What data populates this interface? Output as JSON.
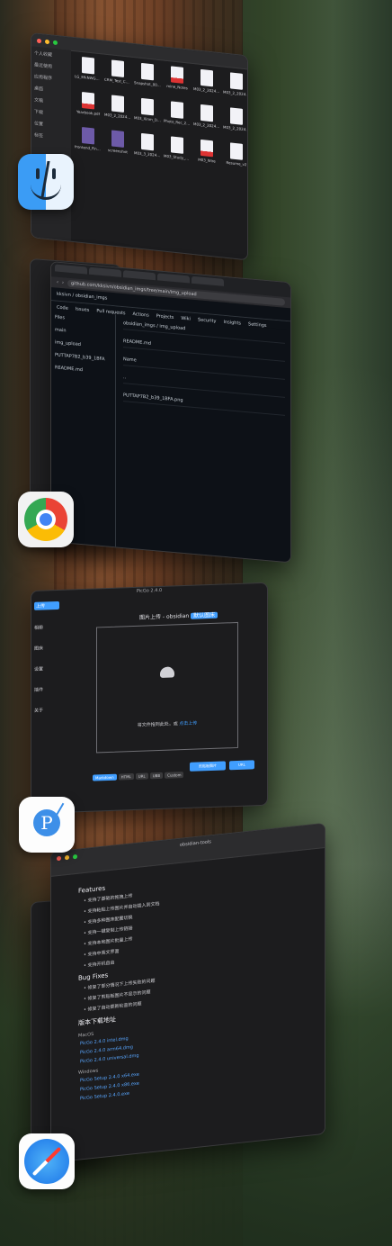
{
  "finder": {
    "sidebar": [
      "个人收藏",
      "最近使用",
      "应用程序",
      "桌面",
      "文稿",
      "下载",
      "位置",
      "标签"
    ],
    "files": [
      {
        "name": "LG_EfkNWGUPM42vF5",
        "kind": "doc"
      },
      {
        "name": "CRM_Test_Core",
        "kind": "doc"
      },
      {
        "name": "Snapshot_00001",
        "kind": "doc"
      },
      {
        "name": "mine_Notes",
        "kind": "pdf"
      },
      {
        "name": "M03_2_2024-12_A_Attach",
        "kind": "doc"
      },
      {
        "name": "M03_2_2024-12_A_Attach",
        "kind": "doc"
      },
      {
        "name": "Yearbook.pdf",
        "kind": "pdf"
      },
      {
        "name": "M03_2_2024_9_10.docx",
        "kind": "doc"
      },
      {
        "name": "M03_Xinm_Design.pdf",
        "kind": "doc"
      },
      {
        "name": "Photo_Rec_2024.pdf",
        "kind": "doc"
      },
      {
        "name": "M03_2_2024_10_11.docx",
        "kind": "doc"
      },
      {
        "name": "M03_2_2024_10_11.docx",
        "kind": "doc"
      },
      {
        "name": "frontend_Final.pdf",
        "kind": "img"
      },
      {
        "name": "screenshot",
        "kind": "img"
      },
      {
        "name": "M03_3_2024_10_11.docx",
        "kind": "doc"
      },
      {
        "name": "M03_Study_Notes.pdf",
        "kind": "doc"
      },
      {
        "name": "M03_Wire",
        "kind": "pdf"
      },
      {
        "name": "Resume_v2",
        "kind": "doc"
      }
    ]
  },
  "chrome": {
    "url": "github.com/kksivn/obsidian_imgs/tree/main/img_upload",
    "repo": "kksivn / obsidian_imgs",
    "nav": [
      "Code",
      "Issues",
      "Pull requests",
      "Actions",
      "Projects",
      "Wiki",
      "Security",
      "Insights",
      "Settings"
    ],
    "files_title": "Files",
    "branch": "main",
    "files": [
      "img_upload",
      "PUTTAP7B2_b39_1BFA",
      "README.md"
    ],
    "breadcrumb": "obsidian_imgs / img_upload",
    "readme_title": "README.md",
    "rows": [
      "Name",
      "..",
      "PUTTAP7B2_b39_1BFA.png"
    ]
  },
  "picgo": {
    "title": "PicGo 2.4.0",
    "nav": [
      "上传",
      "相册",
      "图床",
      "设置",
      "插件",
      "关于"
    ],
    "header": "图片上传 - obsidian",
    "header_tag": "默认图床",
    "drop_text": "将文件拖到此处，或",
    "drop_link": "点击上传",
    "formats": [
      "Markdown",
      "HTML",
      "URL",
      "UBB",
      "Custom"
    ],
    "buttons": [
      "剪贴板图片",
      "URL"
    ]
  },
  "safari": {
    "tab": "obsidian-tools",
    "heading": "Features",
    "items": [
      "支持了基础的拖拽上传",
      "支持粘贴上传图片并自动插入到文档",
      "支持多种图床配置切换",
      "支持一键复制上传链接",
      "支持本地图片批量上传",
      "支持中英文界面",
      "支持开机自启"
    ],
    "bugfix_heading": "Bug Fixes",
    "bugfixes": [
      "修复了部分情况下上传失败的问题",
      "修复了剪贴板图片不显示的问题",
      "修复了自动更新检查的问题"
    ],
    "download_heading": "版本下载地址",
    "macos_label": "MacOS",
    "macos_links": [
      "PicGo 2.4.0 intel.dmg",
      "PicGo 2.4.0 arm64.dmg",
      "PicGo 2.4.0 universal.dmg"
    ],
    "windows_label": "Windows",
    "windows_links": [
      "PicGo Setup 2.4.0 x64.exe",
      "PicGo Setup 2.4.0 x86.exe",
      "PicGo Setup 2.4.0.exe"
    ]
  },
  "apps": {
    "finder": "finder-app-icon",
    "chrome": "chrome-app-icon",
    "picgo": "picgo-app-icon",
    "safari": "safari-app-icon"
  }
}
